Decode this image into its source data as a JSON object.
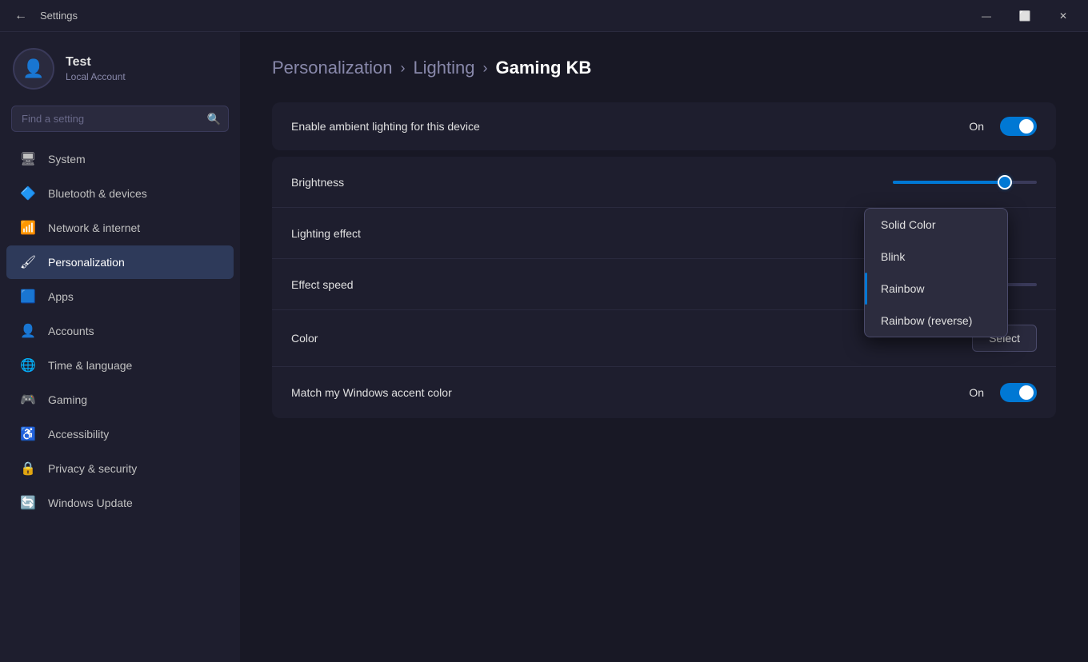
{
  "titleBar": {
    "title": "Settings",
    "controls": {
      "minimize": "—",
      "maximize": "⬜",
      "close": "✕"
    }
  },
  "sidebar": {
    "search": {
      "placeholder": "Find a setting"
    },
    "user": {
      "name": "Test",
      "subtitle": "Local Account"
    },
    "navItems": [
      {
        "id": "system",
        "icon": "🖥",
        "label": "System",
        "active": false
      },
      {
        "id": "bluetooth",
        "icon": "🔵",
        "label": "Bluetooth & devices",
        "active": false
      },
      {
        "id": "network",
        "icon": "📶",
        "label": "Network & internet",
        "active": false
      },
      {
        "id": "personalization",
        "icon": "🖌",
        "label": "Personalization",
        "active": true
      },
      {
        "id": "apps",
        "icon": "🟦",
        "label": "Apps",
        "active": false
      },
      {
        "id": "accounts",
        "icon": "👤",
        "label": "Accounts",
        "active": false
      },
      {
        "id": "time",
        "icon": "🌐",
        "label": "Time & language",
        "active": false
      },
      {
        "id": "gaming",
        "icon": "🎮",
        "label": "Gaming",
        "active": false
      },
      {
        "id": "accessibility",
        "icon": "♿",
        "label": "Accessibility",
        "active": false
      },
      {
        "id": "privacy",
        "icon": "🔒",
        "label": "Privacy & security",
        "active": false
      },
      {
        "id": "windowsupdate",
        "icon": "🔄",
        "label": "Windows Update",
        "active": false
      }
    ]
  },
  "content": {
    "breadcrumb": [
      {
        "label": "Personalization",
        "active": false
      },
      {
        "label": "Lighting",
        "active": false
      },
      {
        "label": "Gaming KB",
        "active": true
      }
    ],
    "enableAmbient": {
      "label": "Enable ambient lighting for this device",
      "toggleOn": true,
      "toggleLabel": "On"
    },
    "rows": [
      {
        "id": "brightness",
        "label": "Brightness",
        "type": "slider",
        "sliderPercent": 78
      },
      {
        "id": "lighting-effect",
        "label": "Lighting effect",
        "type": "dropdown-trigger",
        "currentValue": "Rainbow"
      },
      {
        "id": "effect-speed",
        "label": "Effect speed",
        "type": "slider",
        "sliderPercent": 38
      },
      {
        "id": "color",
        "label": "Color",
        "type": "button",
        "buttonLabel": "Select"
      },
      {
        "id": "accent-color",
        "label": "Match my Windows accent color",
        "type": "toggle",
        "toggleOn": true,
        "toggleLabel": "On"
      }
    ],
    "dropdown": {
      "visible": true,
      "items": [
        {
          "id": "solid-color",
          "label": "Solid Color",
          "selected": false
        },
        {
          "id": "blink",
          "label": "Blink",
          "selected": false
        },
        {
          "id": "rainbow",
          "label": "Rainbow",
          "selected": true
        },
        {
          "id": "rainbow-reverse",
          "label": "Rainbow (reverse)",
          "selected": false
        }
      ]
    }
  }
}
